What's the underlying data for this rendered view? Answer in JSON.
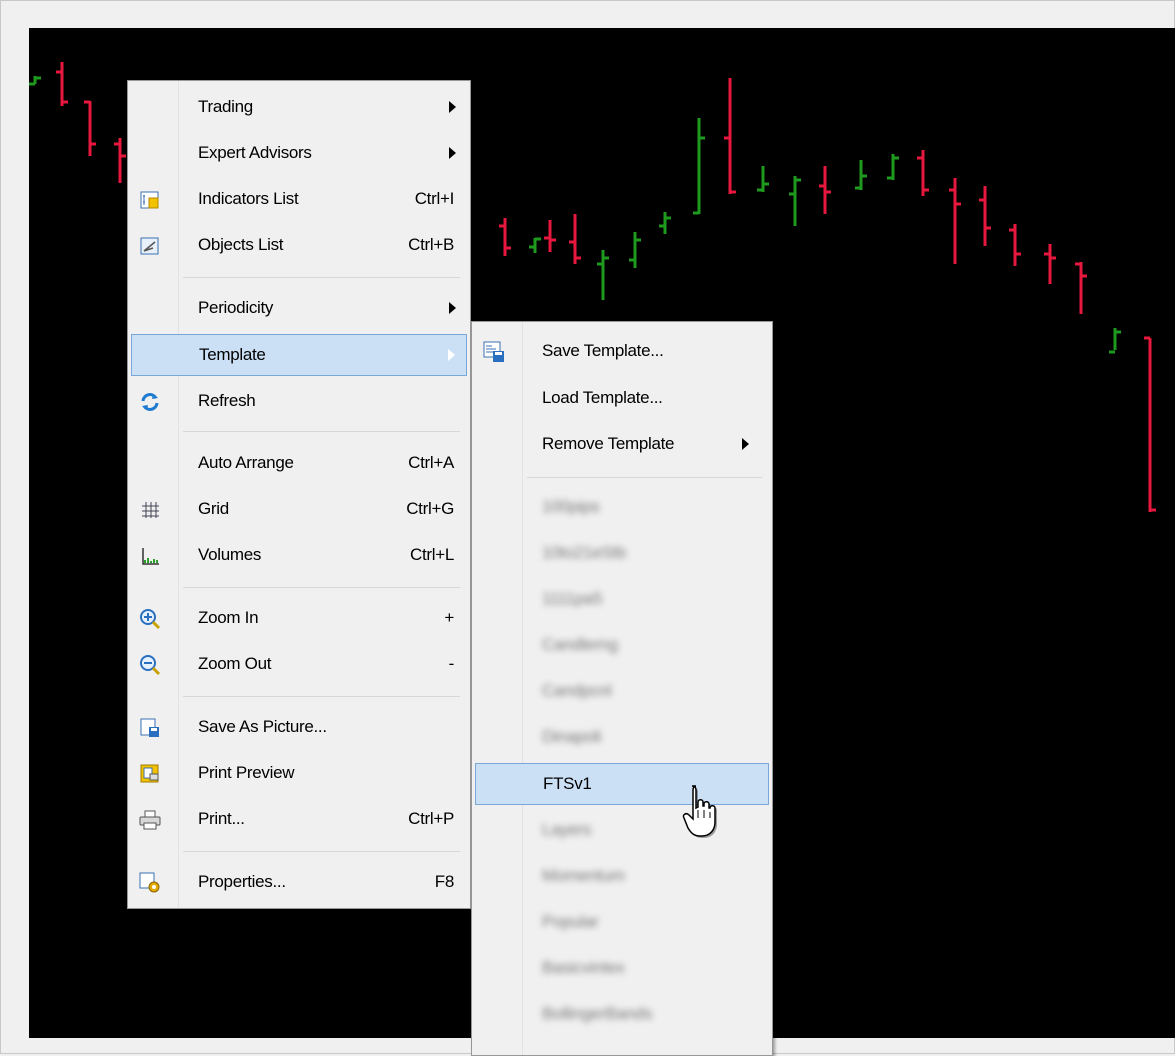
{
  "context_menu": {
    "items": [
      {
        "label": "Trading",
        "submenu": true
      },
      {
        "label": "Expert Advisors",
        "submenu": true
      },
      {
        "label": "Indicators List",
        "shortcut": "Ctrl+I",
        "icon": "indicators-list-icon"
      },
      {
        "label": "Objects List",
        "shortcut": "Ctrl+B",
        "icon": "objects-list-icon"
      },
      {
        "label": "Periodicity",
        "submenu": true
      },
      {
        "label": "Template",
        "submenu": true
      },
      {
        "label": "Refresh",
        "icon": "refresh-icon"
      },
      {
        "label": "Auto Arrange",
        "shortcut": "Ctrl+A"
      },
      {
        "label": "Grid",
        "shortcut": "Ctrl+G",
        "icon": "grid-icon"
      },
      {
        "label": "Volumes",
        "shortcut": "Ctrl+L",
        "icon": "volumes-icon"
      },
      {
        "label": "Zoom In",
        "shortcut": "+",
        "icon": "zoom-in-icon"
      },
      {
        "label": "Zoom Out",
        "shortcut": "-",
        "icon": "zoom-out-icon"
      },
      {
        "label": "Save As Picture...",
        "icon": "save-picture-icon"
      },
      {
        "label": "Print Preview",
        "icon": "print-preview-icon"
      },
      {
        "label": "Print...",
        "shortcut": "Ctrl+P",
        "icon": "printer-icon"
      },
      {
        "label": "Properties...",
        "shortcut": "F8",
        "icon": "properties-icon"
      }
    ],
    "highlighted": "Template"
  },
  "template_submenu": {
    "items": [
      {
        "label": "Save Template...",
        "icon": "save-template-icon"
      },
      {
        "label": "Load Template..."
      },
      {
        "label": "Remove Template",
        "submenu": true
      }
    ],
    "templates": [
      {
        "label": "100pips",
        "blurred": true
      },
      {
        "label": "10to21eStb",
        "blurred": true
      },
      {
        "label": "1111pa5",
        "blurred": true
      },
      {
        "label": "Candlerng",
        "blurred": true
      },
      {
        "label": "Candpcnl",
        "blurred": true
      },
      {
        "label": "Dinapoli",
        "blurred": true
      },
      {
        "label": "FTSv1",
        "blurred": false
      },
      {
        "label": "Layers",
        "blurred": true
      },
      {
        "label": "Momentum",
        "blurred": true
      },
      {
        "label": "Popular",
        "blurred": true
      },
      {
        "label": "Basicvintex",
        "blurred": true
      },
      {
        "label": "BollingerBands",
        "blurred": true
      }
    ],
    "highlighted": "FTSv1"
  },
  "colors": {
    "bull": "#1e9a1e",
    "bear": "#e8173e",
    "chart_bg": "#000000",
    "menu_highlight": "#cce0f5"
  }
}
